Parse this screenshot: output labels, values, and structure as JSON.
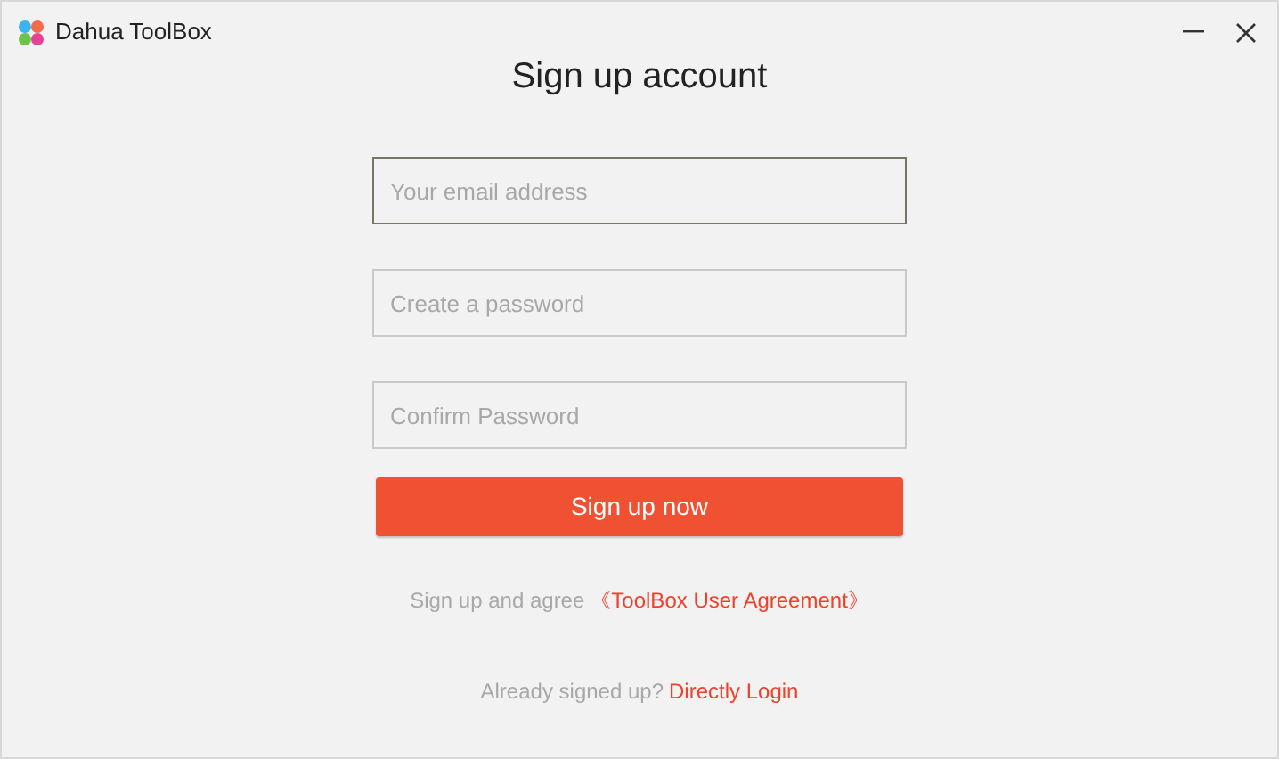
{
  "window": {
    "title": "Dahua ToolBox"
  },
  "heading": "Sign up account",
  "fields": [
    {
      "placeholder": "Your email address",
      "focused": true
    },
    {
      "placeholder": "Create a password",
      "focused": false
    },
    {
      "placeholder": "Confirm Password",
      "focused": false
    }
  ],
  "submit": "Sign up now",
  "agreement": {
    "text": "Sign up and agree",
    "link": "《ToolBox User Agreement》"
  },
  "login": {
    "text": "Already signed up?",
    "link": "Directly Login"
  }
}
